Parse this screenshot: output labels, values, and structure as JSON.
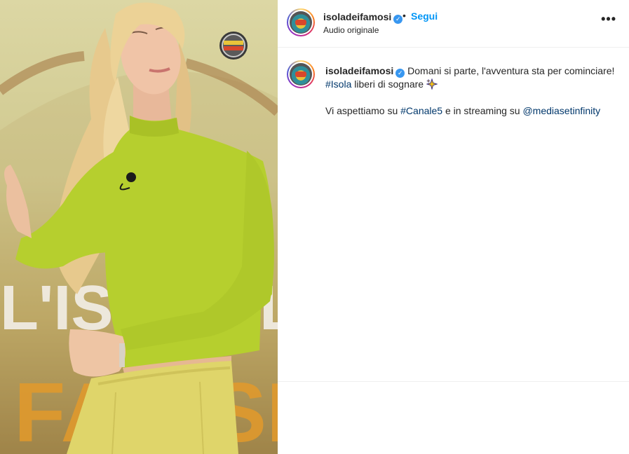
{
  "media": {
    "logo_badge_text": "L'ISOLA DEI FAMOSI",
    "background_sign_text": [
      "L'IS",
      "OLE",
      "FA",
      "SI"
    ]
  },
  "header": {
    "username": "isoladeifamosi",
    "separator": "•",
    "follow_label": "Segui",
    "audio_label": "Audio originale",
    "more_icon": "•••"
  },
  "caption": {
    "username": "isoladeifamosi",
    "line1_text": " Domani si parte, l'avventura sta per cominciare!",
    "hashtag_isola": "#Isola",
    "line2_text": " liberi di sognare ",
    "line3_prefix": "Vi aspettiamo su ",
    "hashtag_canale5": "#Canale5",
    "line3_mid": " e in streaming su ",
    "mention": "@mediasetinfinity"
  },
  "colors": {
    "follow_blue": "#0095f6",
    "hashtag_blue": "#00376b",
    "verified_blue": "#3897f0",
    "sweater_green": "#b6cf2e",
    "pants_yellow": "#dfd56a"
  }
}
